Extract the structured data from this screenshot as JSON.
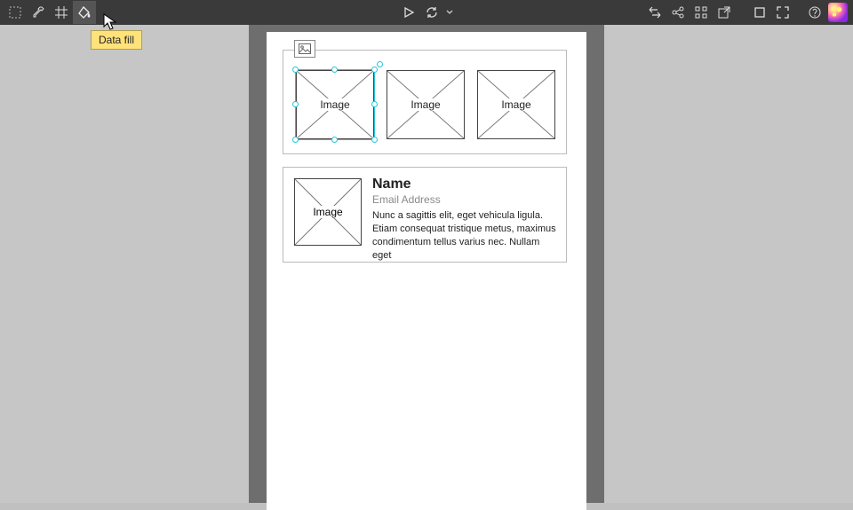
{
  "tooltip": {
    "text": "Data fill"
  },
  "panelTop": {
    "thumbs": [
      {
        "label": "Image"
      },
      {
        "label": "Image"
      },
      {
        "label": "Image"
      }
    ]
  },
  "card": {
    "imageLabel": "Image",
    "name": "Name",
    "email": "Email Address",
    "body": "Nunc a sagittis elit, eget vehicula ligula. Etiam consequat tristique metus, maximus condimentum tellus varius nec. Nullam eget"
  }
}
